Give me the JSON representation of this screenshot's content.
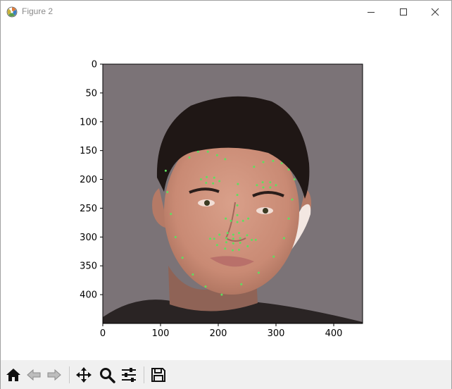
{
  "window": {
    "title": "Figure 2",
    "minimize_icon": "minimize-icon",
    "maximize_icon": "maximize-icon",
    "close_icon": "close-icon"
  },
  "toolbar": {
    "buttons": [
      {
        "name": "home-button",
        "icon": "home-icon",
        "enabled": true
      },
      {
        "name": "back-button",
        "icon": "arrow-left-icon",
        "enabled": false
      },
      {
        "name": "forward-button",
        "icon": "arrow-right-icon",
        "enabled": false
      },
      {
        "name": "pan-button",
        "icon": "move-icon",
        "enabled": true
      },
      {
        "name": "zoom-button",
        "icon": "magnifier-icon",
        "enabled": true
      },
      {
        "name": "configure-subplots-button",
        "icon": "sliders-icon",
        "enabled": true
      },
      {
        "name": "save-button",
        "icon": "floppy-disk-icon",
        "enabled": true
      }
    ]
  },
  "chart_data": {
    "type": "image",
    "description_visible": "photo of a face with green facial landmark points",
    "xlim": [
      0,
      450
    ],
    "ylim": [
      450,
      0
    ],
    "x_ticks": [
      "0",
      "100",
      "200",
      "300",
      "400"
    ],
    "y_ticks": [
      "0",
      "50",
      "100",
      "150",
      "200",
      "250",
      "300",
      "350",
      "400"
    ],
    "background_color": "#7b7377",
    "landmark_color": "#5ee05e",
    "landmarks": [
      [
        109,
        185
      ],
      [
        112,
        222
      ],
      [
        118,
        260
      ],
      [
        126,
        300
      ],
      [
        138,
        336
      ],
      [
        156,
        365
      ],
      [
        178,
        386
      ],
      [
        206,
        400
      ],
      [
        240,
        382
      ],
      [
        270,
        362
      ],
      [
        296,
        334
      ],
      [
        314,
        302
      ],
      [
        322,
        268
      ],
      [
        328,
        235
      ],
      [
        332,
        200
      ],
      [
        150,
        162
      ],
      [
        165,
        152
      ],
      [
        182,
        152
      ],
      [
        198,
        158
      ],
      [
        212,
        165
      ],
      [
        262,
        178
      ],
      [
        278,
        170
      ],
      [
        295,
        168
      ],
      [
        310,
        172
      ],
      [
        322,
        183
      ],
      [
        234,
        208
      ],
      [
        233,
        227
      ],
      [
        233,
        245
      ],
      [
        233,
        262
      ],
      [
        213,
        268
      ],
      [
        222,
        272
      ],
      [
        233,
        274
      ],
      [
        243,
        272
      ],
      [
        252,
        268
      ],
      [
        170,
        200
      ],
      [
        180,
        196
      ],
      [
        193,
        197
      ],
      [
        202,
        203
      ],
      [
        191,
        207
      ],
      [
        179,
        206
      ],
      [
        267,
        210
      ],
      [
        277,
        205
      ],
      [
        290,
        205
      ],
      [
        300,
        210
      ],
      [
        290,
        214
      ],
      [
        278,
        214
      ],
      [
        186,
        303
      ],
      [
        202,
        296
      ],
      [
        216,
        293
      ],
      [
        226,
        296
      ],
      [
        236,
        293
      ],
      [
        250,
        297
      ],
      [
        265,
        305
      ],
      [
        251,
        316
      ],
      [
        236,
        322
      ],
      [
        225,
        323
      ],
      [
        212,
        320
      ],
      [
        198,
        314
      ],
      [
        193,
        303
      ],
      [
        214,
        302
      ],
      [
        226,
        303
      ],
      [
        238,
        302
      ],
      [
        258,
        305
      ],
      [
        238,
        310
      ],
      [
        226,
        311
      ],
      [
        214,
        309
      ]
    ]
  }
}
